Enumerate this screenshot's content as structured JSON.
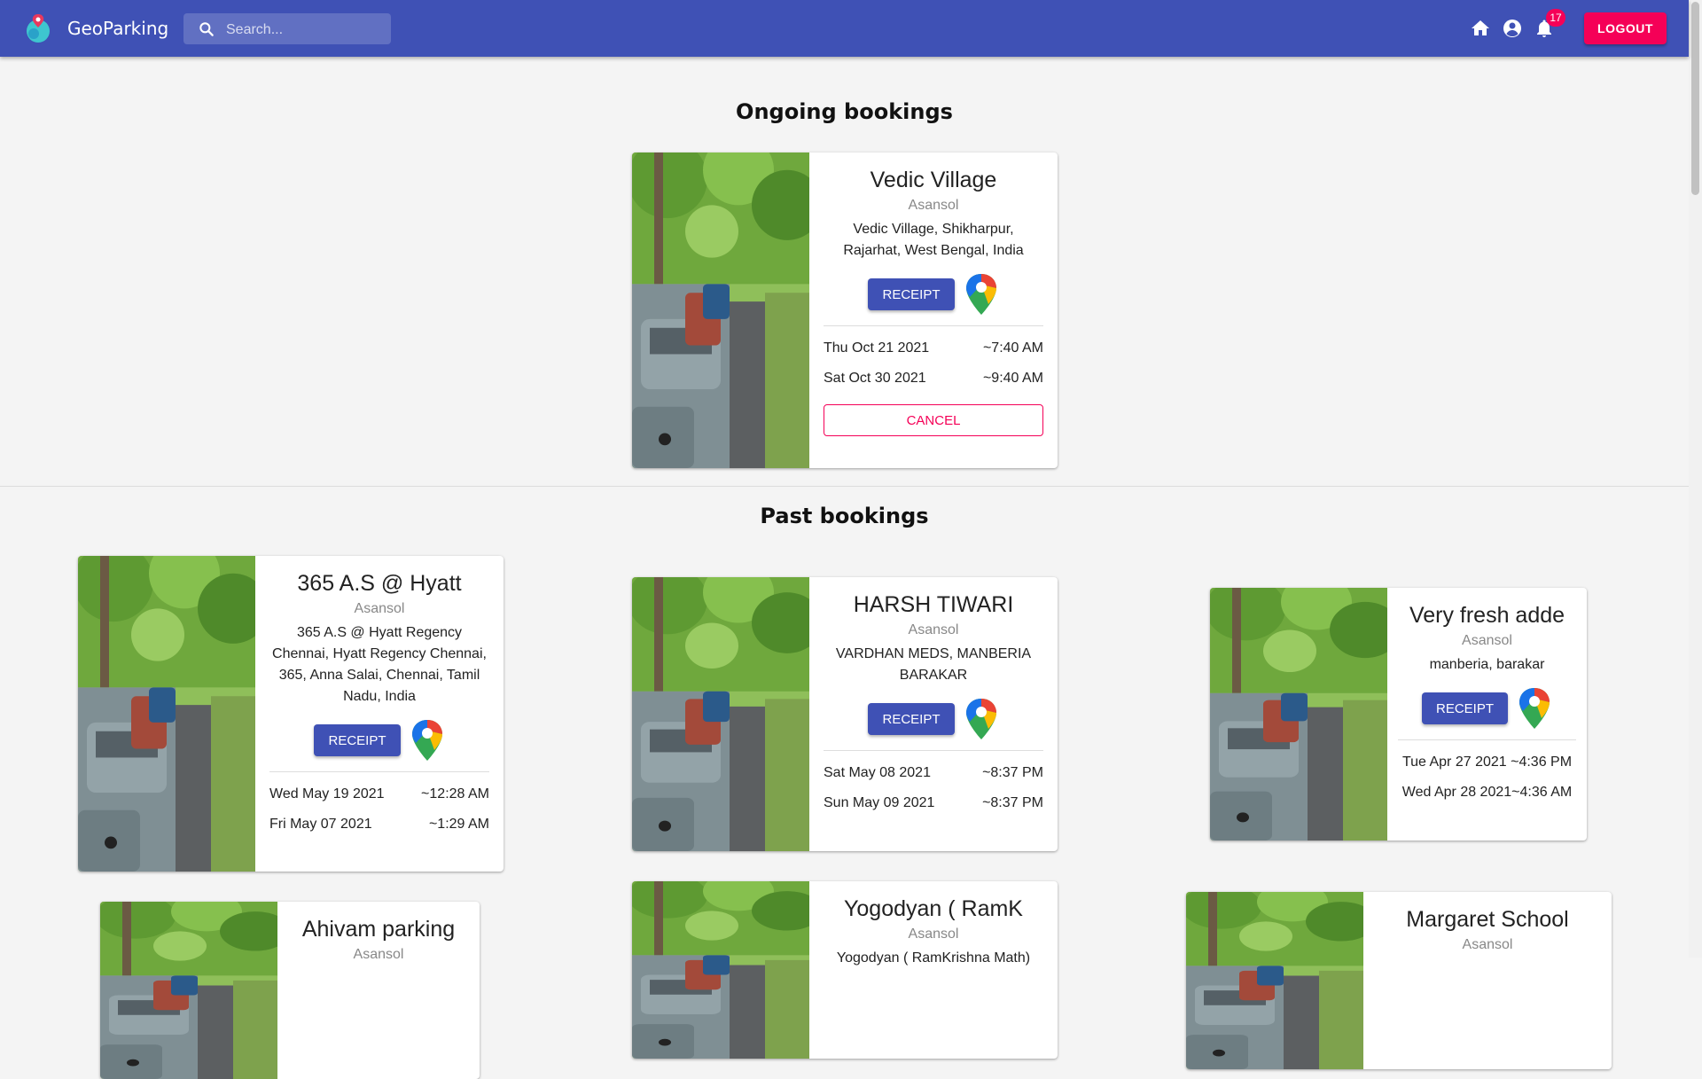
{
  "app": {
    "brand": "GeoParking",
    "search_placeholder": "Search...",
    "notification_count": "17",
    "logout_label": "LOGOUT",
    "accent": "#3f51b5",
    "secondary": "#f50057"
  },
  "ongoing": {
    "title": "Ongoing bookings",
    "cards": [
      {
        "name": "Vedic Village",
        "city": "Asansol",
        "address": "Vedic Village, Shikharpur, Rajarhat, West Bengal, India",
        "receipt_label": "RECEIPT",
        "start_date": "Thu Oct 21 2021",
        "start_time": "~7:40 AM",
        "end_date": "Sat Oct 30 2021",
        "end_time": "~9:40 AM",
        "cancel_label": "CANCEL"
      }
    ]
  },
  "past": {
    "title": "Past bookings",
    "cards": [
      {
        "name": "365 A.S @ Hyatt",
        "city": "Asansol",
        "address": "365 A.S @ Hyatt Regency Chennai, Hyatt Regency Chennai, 365, Anna Salai, Chennai, Tamil Nadu, India",
        "receipt_label": "RECEIPT",
        "start_date": "Wed May 19 2021",
        "start_time": "~12:28 AM",
        "end_date": "Fri May 07 2021",
        "end_time": "~1:29 AM"
      },
      {
        "name": "HARSH TIWARI",
        "city": "Asansol",
        "address": "VARDHAN MEDS, MANBERIA BARAKAR",
        "receipt_label": "RECEIPT",
        "start_date": "Sat May 08 2021",
        "start_time": "~8:37 PM",
        "end_date": "Sun May 09 2021",
        "end_time": "~8:37 PM"
      },
      {
        "name": "Very fresh adde",
        "city": "Asansol",
        "address": "manberia, barakar",
        "receipt_label": "RECEIPT",
        "start_date": "Tue Apr 27 2021",
        "start_time": "~4:36 PM",
        "end_date": "Wed Apr 28 2021",
        "end_time": "~4:36 AM"
      },
      {
        "name": "Ahivam parking",
        "city": "Asansol"
      },
      {
        "name": "Yogodyan ( RamK",
        "city": "Asansol",
        "address": "Yogodyan ( RamKrishna Math)"
      },
      {
        "name": "Margaret School",
        "city": "Asansol"
      }
    ]
  }
}
